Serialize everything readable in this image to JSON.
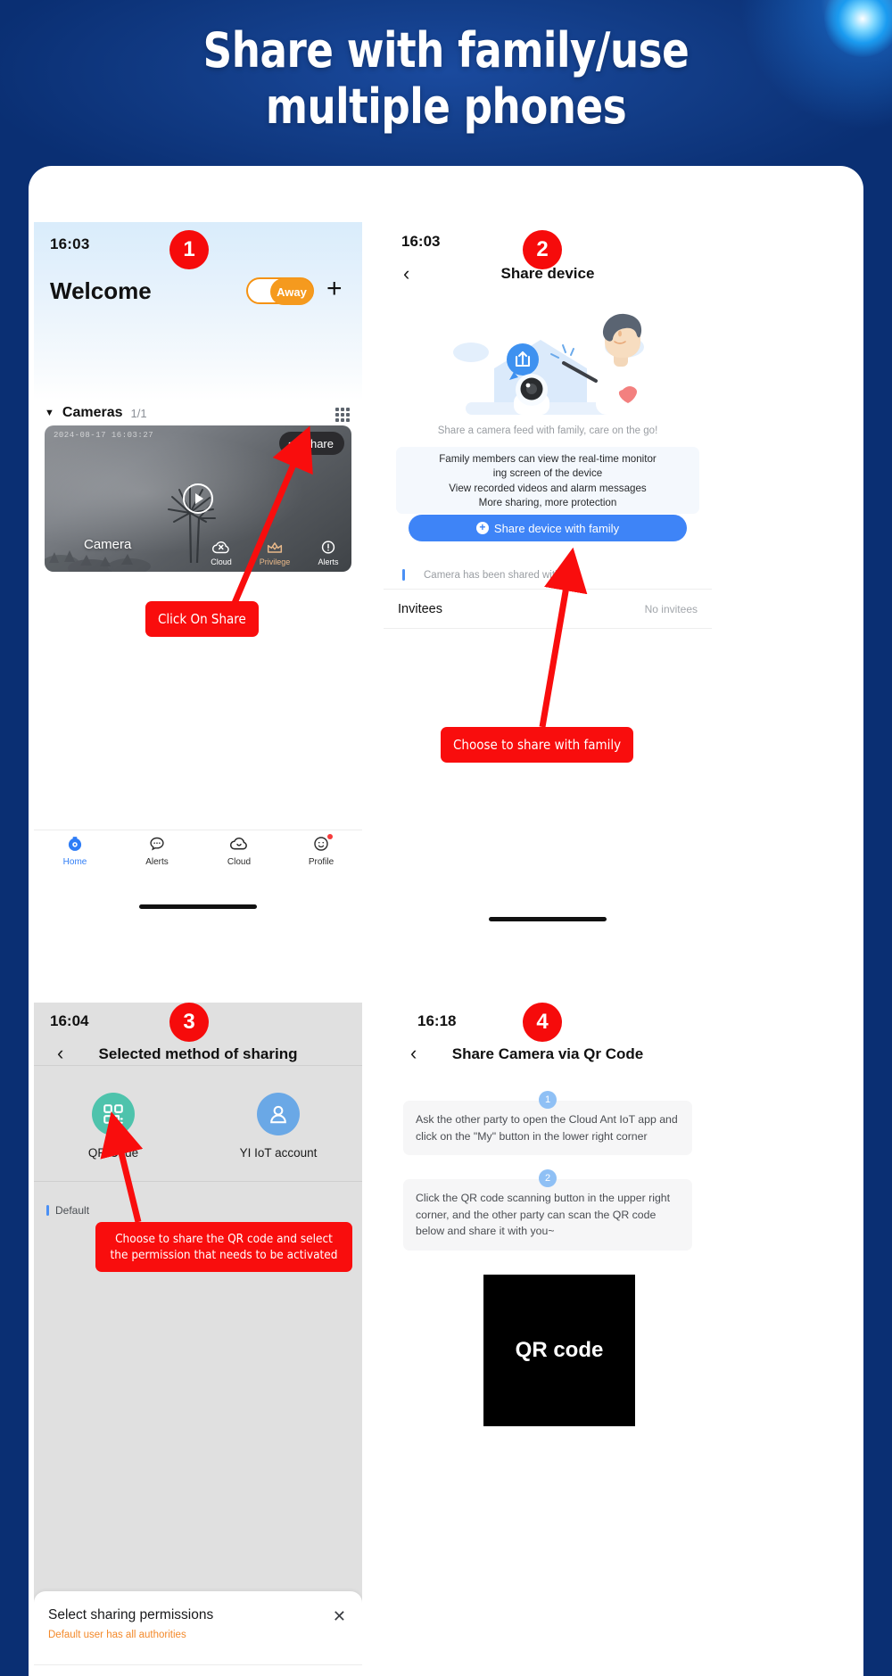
{
  "hero": {
    "title_line1": "Share with family/use",
    "title_line2": "multiple phones"
  },
  "panel1": {
    "time": "16:03",
    "welcome": "Welcome",
    "away_label": "Away",
    "plus": "+",
    "cameras_label": "Cameras",
    "cameras_count": "1/1",
    "video_timestamp": "2024-08-17 16:03:27",
    "share_button": "Share",
    "camera_name": "Camera",
    "card_actions": [
      {
        "label": "Cloud",
        "icon": "cloud-disabled-icon"
      },
      {
        "label": "Privilege",
        "icon": "crown-icon"
      },
      {
        "label": "Alerts",
        "icon": "alert-icon"
      }
    ],
    "nav": [
      {
        "label": "Home",
        "icon": "camera-home-icon",
        "active": true,
        "dot": false
      },
      {
        "label": "Alerts",
        "icon": "chat-bubble-icon",
        "active": false,
        "dot": false
      },
      {
        "label": "Cloud",
        "icon": "cloud-icon",
        "active": false,
        "dot": false
      },
      {
        "label": "Profile",
        "icon": "profile-face-icon",
        "active": false,
        "dot": true
      }
    ]
  },
  "panel2": {
    "time": "16:03",
    "title": "Share device",
    "subtitle": "Share a camera feed with family, care on the go!",
    "info_lines": [
      "Family members can view the real-time monitor",
      "ing screen of the device",
      "View recorded videos and alarm messages",
      "More sharing, more protection"
    ],
    "cta_label": "Share device with family",
    "shared_with_label": "Camera has been shared with:",
    "invitees_label": "Invitees",
    "invitees_value": "No invitees"
  },
  "panel3": {
    "time": "16:04",
    "title": "Selected method of sharing",
    "methods": [
      {
        "label": "QR Code",
        "icon": "qr-code-icon",
        "color": "#4ec3ac"
      },
      {
        "label": "YI IoT account",
        "icon": "account-avatar-icon",
        "color": "#6aa8e6"
      }
    ],
    "default_label": "Default",
    "sheet_title": "Select sharing permissions",
    "sheet_subtitle": "Default user has all authorities",
    "sheet_close": "✕"
  },
  "panel4": {
    "time": "16:18",
    "title": "Share Camera via Qr Code",
    "steps": [
      {
        "num": "1",
        "text": "Ask the other party to open the Cloud Ant IoT app and click on the \"My\" button in the lower right corner"
      },
      {
        "num": "2",
        "text": "Click the QR code scanning button in the upper right corner, and the other party can scan the QR code below and share it with you~"
      }
    ],
    "qr_label": "QR code"
  },
  "annotations": {
    "badges": [
      "1",
      "2",
      "3",
      "4"
    ],
    "callouts": [
      "Click On Share",
      "Choose to share with family",
      "Choose to share the QR code and select the permission that needs to be activated"
    ],
    "accent_red": "#f90d0d"
  }
}
